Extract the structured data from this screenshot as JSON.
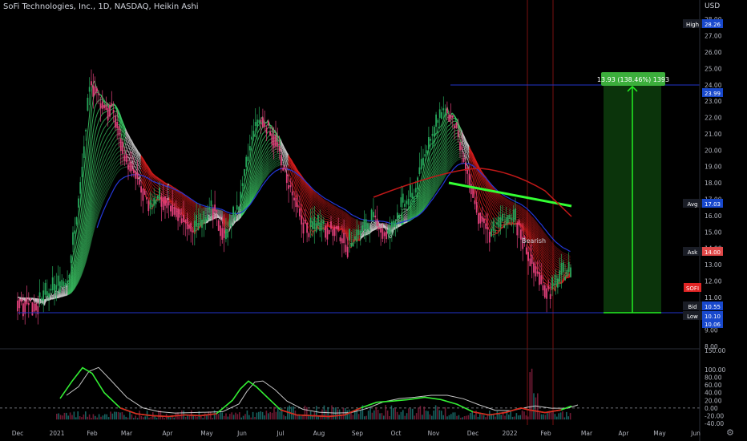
{
  "header": {
    "title": "SoFi Technologies, Inc., 1D, NASDAQ, Heikin Ashi",
    "currency": "USD",
    "settings_icon": "gear-icon"
  },
  "chart_data": [
    {
      "type": "candlestick",
      "series": "SoFi Technologies, Inc. daily (Heikin Ashi)",
      "ylim": [
        8.0,
        28.5
      ],
      "y_ticks": [
        "8.00",
        "9.00",
        "10.00",
        "11.00",
        "12.00",
        "13.00",
        "14.00",
        "15.00",
        "16.00",
        "17.00",
        "18.00",
        "19.00",
        "20.00",
        "21.00",
        "22.00",
        "23.00",
        "24.00",
        "25.00",
        "26.00",
        "27.00",
        "28.00"
      ],
      "x_ticks": [
        "Dec",
        "2021",
        "Feb",
        "Mar",
        "Apr",
        "May",
        "Jun",
        "Jul",
        "Aug",
        "Sep",
        "Oct",
        "Nov",
        "Dec",
        "2022",
        "Feb",
        "Mar",
        "Apr",
        "May",
        "Jun"
      ],
      "price_path": [
        [
          "2020-12-01",
          11.0
        ],
        [
          "2020-12-20",
          10.7
        ],
        [
          "2021-01-10",
          12.0
        ],
        [
          "2021-01-20",
          17.5
        ],
        [
          "2021-01-28",
          24.5
        ],
        [
          "2021-02-05",
          23.0
        ],
        [
          "2021-02-15",
          22.5
        ],
        [
          "2021-02-25",
          19.5
        ],
        [
          "2021-03-05",
          18.5
        ],
        [
          "2021-03-15",
          16.5
        ],
        [
          "2021-03-25",
          17.2
        ],
        [
          "2021-04-05",
          16.5
        ],
        [
          "2021-04-20",
          15.0
        ],
        [
          "2021-05-05",
          16.5
        ],
        [
          "2021-05-15",
          14.7
        ],
        [
          "2021-05-25",
          16.5
        ],
        [
          "2021-06-05",
          21.0
        ],
        [
          "2021-06-12",
          22.0
        ],
        [
          "2021-06-22",
          21.0
        ],
        [
          "2021-07-01",
          18.5
        ],
        [
          "2021-07-10",
          16.5
        ],
        [
          "2021-07-20",
          15.0
        ],
        [
          "2021-08-01",
          15.5
        ],
        [
          "2021-08-10",
          15.2
        ],
        [
          "2021-08-20",
          14.2
        ],
        [
          "2021-09-01",
          15.0
        ],
        [
          "2021-09-10",
          15.8
        ],
        [
          "2021-09-20",
          14.7
        ],
        [
          "2021-10-01",
          16.5
        ],
        [
          "2021-10-10",
          17.0
        ],
        [
          "2021-10-20",
          20.0
        ],
        [
          "2021-10-28",
          21.5
        ],
        [
          "2021-11-05",
          22.5
        ],
        [
          "2021-11-12",
          21.5
        ],
        [
          "2021-11-20",
          19.0
        ],
        [
          "2021-12-01",
          16.0
        ],
        [
          "2021-12-10",
          15.0
        ],
        [
          "2021-12-20",
          15.5
        ],
        [
          "2022-01-01",
          15.5
        ],
        [
          "2022-01-10",
          13.5
        ],
        [
          "2022-01-20",
          12.0
        ],
        [
          "2022-01-27",
          11.3
        ],
        [
          "2022-02-05",
          12.3
        ],
        [
          "2022-02-15",
          12.5
        ],
        [
          "2022-02-24",
          12.0
        ]
      ],
      "high_line": 23.99,
      "low_line": 10.06,
      "annotation_label": "Bearish",
      "measure": {
        "label": "13.93 (138.46%) 1393",
        "from": 10.06,
        "to": 23.99
      },
      "price_labels": [
        {
          "name": "High",
          "value": "28.26",
          "color": "#1848cc"
        },
        {
          "name": "",
          "value": "23.99",
          "color": "#1848cc"
        },
        {
          "name": "Avg",
          "value": "17.03",
          "color": "#1848cc"
        },
        {
          "name": "Ask",
          "value": "14.00",
          "color": "#e04848"
        },
        {
          "name": "",
          "value": "SOFI",
          "color": "#e02424"
        },
        {
          "name": "Bid",
          "value": "10.55",
          "color": "#1848cc"
        },
        {
          "name": "Low",
          "value": "10.10",
          "color": "#1848cc"
        },
        {
          "name": "",
          "value": "10.06",
          "color": "#1848cc"
        }
      ]
    },
    {
      "type": "oscillator",
      "ylim": [
        -40.0,
        150.0
      ],
      "y_ticks": [
        "150.00",
        "100.00",
        "80.00",
        "60.00",
        "40.00",
        "20.00",
        "0.00",
        "-20.00",
        "-40.00"
      ],
      "zero_line": 0.0
    }
  ],
  "colors": {
    "background": "#000000",
    "up": "#26a65a",
    "down": "#e0407a",
    "ribbon_bull": "#3fd06a",
    "ribbon_bear": "#d81e1e",
    "ribbon_neutral": "#c8c8c8",
    "measure_fill": "#0d3d0d",
    "measure_line": "#22ee22",
    "level_line": "#2233cc"
  }
}
